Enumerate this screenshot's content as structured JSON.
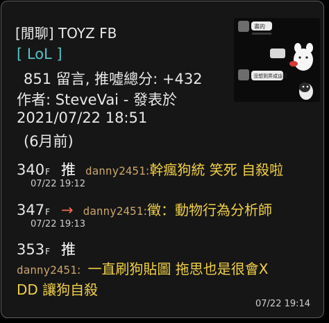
{
  "post": {
    "title": "[閒聊] TOYZ FB",
    "board": "[ LoL ]",
    "stats": "851 留言, 推噓總分: +432",
    "author_line": "作者: SteveVai - 發表於",
    "date": "2021/07/22 18:51",
    "ago": "(6月前)"
  },
  "thumbnail": {
    "bubble1": "晝的",
    "bubble2": "沒想到弄成這樣"
  },
  "comments": [
    {
      "floor": "340",
      "floor_suffix": "F",
      "tag": "推",
      "user": "danny2451",
      "sep": ":",
      "content": "幹瘋狗統 笑死 自殺啦",
      "time": "07/22 19:12"
    },
    {
      "floor": "347",
      "floor_suffix": "F",
      "tag": "→",
      "user": "danny2451",
      "sep": ":",
      "content": "徵：動物行為分析師",
      "time": "07/22 19:13"
    },
    {
      "floor": "353",
      "floor_suffix": "F",
      "tag": "推",
      "user": "danny2451",
      "sep": ":",
      "content": "一直刷狗貼圖 拖思也是很會X",
      "content2": "DD 讓狗自殺",
      "time": "07/22 19:14"
    }
  ],
  "colors": {
    "accent": "#57c4c8",
    "user": "#c9a46a",
    "content": "#f0d047",
    "arrow": "#f36b50"
  }
}
